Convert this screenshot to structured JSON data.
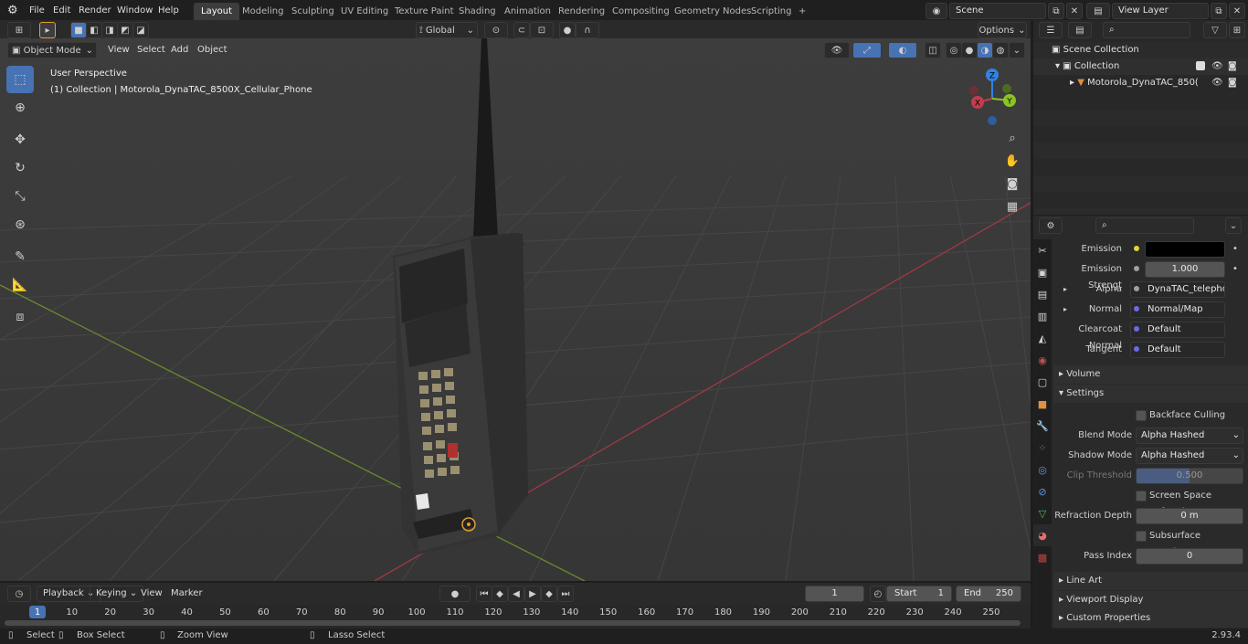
{
  "topbar": {
    "menus": [
      "File",
      "Edit",
      "Render",
      "Window",
      "Help"
    ],
    "workspaces": [
      "Layout",
      "Modeling",
      "Sculpting",
      "UV Editing",
      "Texture Paint",
      "Shading",
      "Animation",
      "Rendering",
      "Compositing",
      "Geometry Nodes",
      "Scripting"
    ],
    "add_tab": "+",
    "scene": "Scene",
    "view_layer": "View Layer"
  },
  "viewport_header": {
    "mode": "Object Mode",
    "menus": [
      "View",
      "Select",
      "Add",
      "Object"
    ],
    "orientation": "Global",
    "options": "Options"
  },
  "viewport": {
    "perspective": "User Perspective",
    "collection_line": "(1) Collection | Motorola_DynaTAC_8500X_Cellular_Phone",
    "gizmo": {
      "z": "Z",
      "y": "Y",
      "x": "X"
    }
  },
  "outliner": {
    "scene_collection": "Scene Collection",
    "collection": "Collection",
    "object": "Motorola_DynaTAC_850("
  },
  "properties": {
    "emission_label": "Emission",
    "emission_strength_label": "Emission Strengt",
    "emission_strength": "1.000",
    "alpha_label": "Alpha",
    "alpha_value": "DynaTAC_telephon...",
    "normal_label": "Normal",
    "normal_value": "Normal/Map",
    "clearcoat_label": "Clearcoat Normal",
    "clearcoat_value": "Default",
    "tangent_label": "Tangent",
    "tangent_value": "Default",
    "volume": "Volume",
    "settings": "Settings",
    "backface": "Backface Culling",
    "blend_label": "Blend Mode",
    "blend_value": "Alpha Hashed",
    "shadow_label": "Shadow Mode",
    "shadow_value": "Alpha Hashed",
    "clip_label": "Clip Threshold",
    "clip_value": "0.500",
    "ssr": "Screen Space Refraction",
    "refraction_label": "Refraction Depth",
    "refraction_value": "0 m",
    "subsurface": "Subsurface Translucency",
    "pass_label": "Pass Index",
    "pass_value": "0",
    "line_art": "Line Art",
    "viewport_display": "Viewport Display",
    "custom_props": "Custom Properties"
  },
  "timeline": {
    "menus": [
      "Playback",
      "Keying",
      "View",
      "Marker"
    ],
    "current_frame": "1",
    "start_label": "Start",
    "start": "1",
    "end_label": "End",
    "end": "250",
    "ticks": [
      "1",
      "10",
      "20",
      "30",
      "40",
      "50",
      "60",
      "70",
      "80",
      "90",
      "100",
      "110",
      "120",
      "130",
      "140",
      "150",
      "160",
      "170",
      "180",
      "190",
      "200",
      "210",
      "220",
      "230",
      "240",
      "250"
    ]
  },
  "statusbar": {
    "select": "Select",
    "box_select": "Box Select",
    "zoom_view": "Zoom View",
    "lasso_select": "Lasso Select",
    "version": "2.93.4"
  },
  "colors": {
    "accent": "#4772b3",
    "x_axis": "#c33c4c",
    "y_axis": "#8bc322",
    "z_axis": "#2f83e5"
  }
}
